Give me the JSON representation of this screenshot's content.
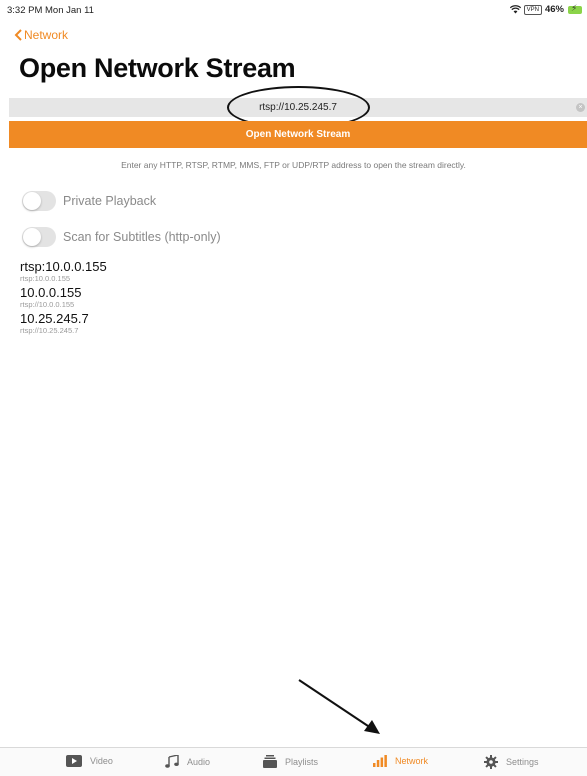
{
  "status_bar": {
    "time": "3:32 PM  Mon Jan 11",
    "vpn": "VPN",
    "battery": "46%"
  },
  "nav": {
    "back_label": "Network"
  },
  "title": "Open Network Stream",
  "url_field": {
    "value": "rtsp://10.25.245.7",
    "clear_icon": "×"
  },
  "open_button": {
    "label": "Open Network Stream"
  },
  "hint": "Enter any HTTP, RTSP, RTMP, MMS, FTP or UDP/RTP address to open the stream directly.",
  "toggles": [
    {
      "label": "Private Playback",
      "on": false
    },
    {
      "label": "Scan for Subtitles (http-only)",
      "on": false
    }
  ],
  "history": [
    {
      "title": "rtsp:10.0.0.155",
      "subtitle": "rtsp:10.0.0.155"
    },
    {
      "title": "10.0.0.155",
      "subtitle": "rtsp://10.0.0.155"
    },
    {
      "title": "10.25.245.7",
      "subtitle": "rtsp://10.25.245.7"
    }
  ],
  "tabs": [
    {
      "label": "Video",
      "icon": "video-icon",
      "active": false
    },
    {
      "label": "Audio",
      "icon": "music-note-icon",
      "active": false
    },
    {
      "label": "Playlists",
      "icon": "playlists-icon",
      "active": false
    },
    {
      "label": "Network",
      "icon": "network-bars-icon",
      "active": true
    },
    {
      "label": "Settings",
      "icon": "gear-icon",
      "active": false
    }
  ],
  "colors": {
    "accent": "#f08a24",
    "field_bg": "#e6e6e6",
    "inactive_tab": "#8e8e8e"
  }
}
